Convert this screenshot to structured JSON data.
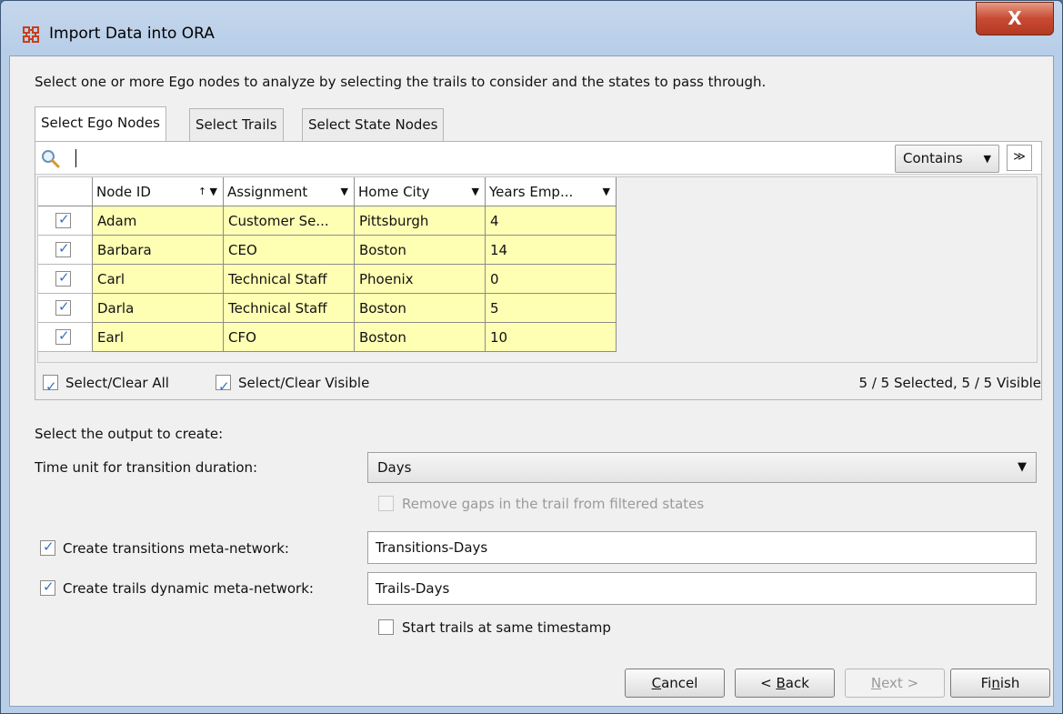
{
  "window": {
    "title": "Import Data into ORA",
    "close_label": "X"
  },
  "instructions": "Select one or more Ego nodes to analyze by selecting the trails to consider and the states to pass through.",
  "tabs": [
    {
      "label": "Select Ego Nodes",
      "active": true
    },
    {
      "label": "Select Trails",
      "active": false
    },
    {
      "label": "Select State Nodes",
      "active": false
    }
  ],
  "search": {
    "value": "",
    "mode": "Contains",
    "expand_glyph": "≫"
  },
  "table": {
    "columns": [
      {
        "label": "Node ID",
        "sort": "↑ ▼"
      },
      {
        "label": "Assignment",
        "sort": "▼"
      },
      {
        "label": "Home City",
        "sort": "▼"
      },
      {
        "label": "Years Emp...",
        "sort": "▼"
      }
    ],
    "rows": [
      {
        "checked": true,
        "cells": [
          "Adam",
          "Customer Se...",
          "Pittsburgh",
          "4"
        ]
      },
      {
        "checked": true,
        "cells": [
          "Barbara",
          "CEO",
          "Boston",
          "14"
        ]
      },
      {
        "checked": true,
        "cells": [
          "Carl",
          "Technical Staff",
          "Phoenix",
          "0"
        ]
      },
      {
        "checked": true,
        "cells": [
          "Darla",
          "Technical Staff",
          "Boston",
          "5"
        ]
      },
      {
        "checked": true,
        "cells": [
          "Earl",
          "CFO",
          "Boston",
          "10"
        ]
      }
    ]
  },
  "selection": {
    "select_all_label": "Select/Clear All",
    "select_visible_label": "Select/Clear Visible",
    "status": "5 / 5 Selected, 5 / 5 Visible"
  },
  "output": {
    "heading": "Select the output to create:",
    "time_unit_label": "Time unit for transition duration:",
    "time_unit_value": "Days",
    "remove_gaps_label": "Remove gaps in the trail from filtered states",
    "transitions_label": "Create transitions meta-network:",
    "transitions_value": "Transitions-Days",
    "trails_label": "Create trails dynamic meta-network:",
    "trails_value": "Trails-Days",
    "start_trails_label": "Start trails at same timestamp"
  },
  "buttons": {
    "cancel": {
      "pre": "",
      "mn": "C",
      "post": "ancel"
    },
    "back": {
      "pre": "< ",
      "mn": "B",
      "post": "ack"
    },
    "next": {
      "pre": "",
      "mn": "N",
      "post": "ext >"
    },
    "finish": {
      "pre": "Fi",
      "mn": "n",
      "post": "ish"
    }
  },
  "colors": {
    "cell_highlight": "#ffffb4",
    "close_button": "#c74a32",
    "checkmark": "#3a6fc0"
  }
}
